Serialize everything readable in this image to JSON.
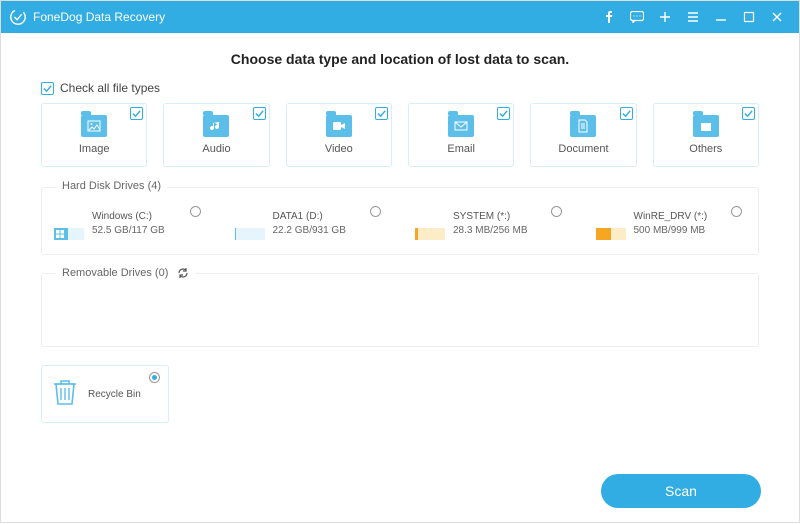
{
  "titlebar": {
    "app_name": "FoneDog Data Recovery"
  },
  "heading": "Choose data type and location of lost data to scan.",
  "checkall_label": "Check all file types",
  "types": [
    {
      "label": "Image"
    },
    {
      "label": "Audio"
    },
    {
      "label": "Video"
    },
    {
      "label": "Email"
    },
    {
      "label": "Document"
    },
    {
      "label": "Others"
    }
  ],
  "groups": {
    "hdd_legend": "Hard Disk Drives (4)",
    "removable_legend": "Removable Drives (0)"
  },
  "drives": [
    {
      "name": "Windows (C:)",
      "size": "52.5 GB/117 GB",
      "fill_pct": 45,
      "style": "sys",
      "winlogo": true
    },
    {
      "name": "DATA1 (D:)",
      "size": "22.2 GB/931 GB",
      "fill_pct": 3,
      "style": "sys",
      "winlogo": false
    },
    {
      "name": "SYSTEM (*:)",
      "size": "28.3 MB/256 MB",
      "fill_pct": 11,
      "style": "orange",
      "winlogo": false
    },
    {
      "name": "WinRE_DRV (*:)",
      "size": "500 MB/999 MB",
      "fill_pct": 50,
      "style": "orange",
      "winlogo": false
    }
  ],
  "recycle": {
    "label": "Recycle Bin",
    "selected": true
  },
  "scan_button": "Scan"
}
